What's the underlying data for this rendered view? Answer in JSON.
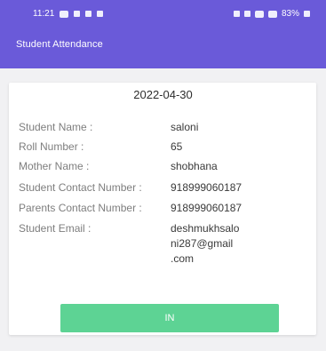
{
  "status": {
    "time": "11:21",
    "battery": "83%"
  },
  "app": {
    "title": "Student Attendance"
  },
  "record": {
    "date": "2022-04-30",
    "fields": [
      {
        "label": "Student Name :",
        "value": "saloni"
      },
      {
        "label": "Roll Number :",
        "value": "65"
      },
      {
        "label": "Mother Name :",
        "value": "shobhana"
      },
      {
        "label": "Student Contact Number :",
        "value": "918999060187"
      },
      {
        "label": "Parents Contact Number :",
        "value": "918999060187"
      },
      {
        "label": "Student Email :",
        "value_lines": [
          "deshmukhsalo",
          "ni287@gmail",
          ".com"
        ]
      }
    ]
  },
  "actions": {
    "in_label": "IN"
  },
  "colors": {
    "appbar": "#6a5ad9",
    "button": "#5dd394"
  }
}
